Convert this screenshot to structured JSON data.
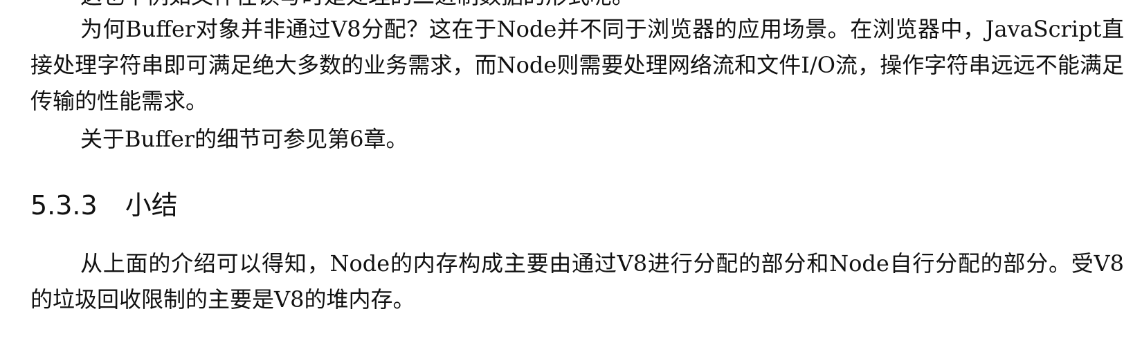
{
  "document": {
    "cut_line": "这也不例如文件在读写时是处理的二进制数据的形式呢。",
    "paragraphs": [
      "为何Buffer对象并非通过V8分配？这在于Node并不同于浏览器的应用场景。在浏览器中，JavaScript直接处理字符串即可满足绝大多数的业务需求，而Node则需要处理网络流和文件I/O流，操作字符串远远不能满足传输的性能需求。",
      "关于Buffer的细节可参见第6章。",
      "从上面的介绍可以得知，Node的内存构成主要由通过V8进行分配的部分和Node自行分配的部分。受V8的垃圾回收限制的主要是V8的堆内存。"
    ],
    "section": {
      "number": "5.3.3",
      "title": "小结"
    }
  }
}
